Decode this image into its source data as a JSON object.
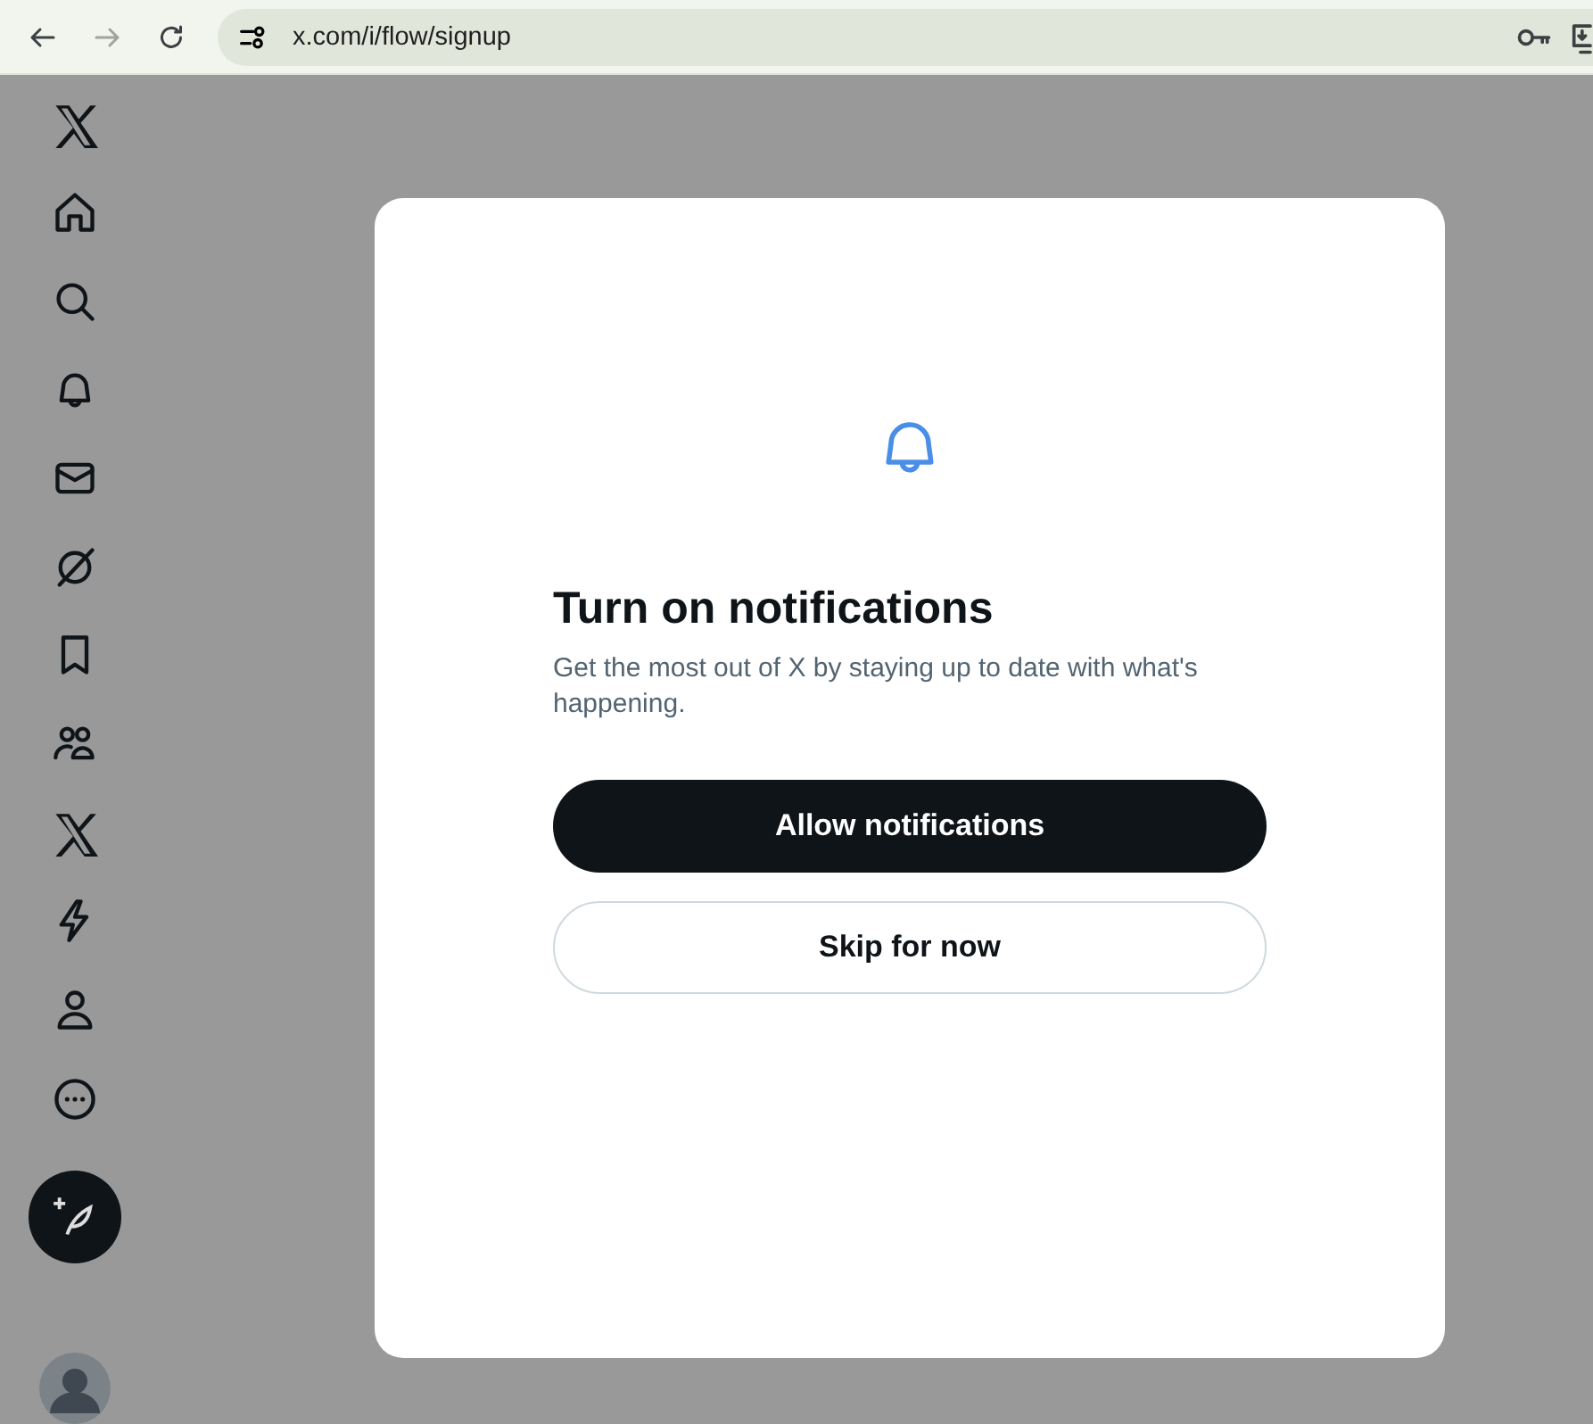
{
  "browser": {
    "nav": [
      {
        "kind": "back",
        "disabled": false
      },
      {
        "kind": "forward",
        "disabled": true
      },
      {
        "kind": "reload",
        "disabled": false
      }
    ],
    "url": "x.com/i/flow/signup"
  },
  "sidebar": {
    "items": [
      {
        "kind": "logo"
      },
      {
        "kind": "home"
      },
      {
        "kind": "search"
      },
      {
        "kind": "bell"
      },
      {
        "kind": "mail"
      },
      {
        "kind": "grok"
      },
      {
        "kind": "bookmark"
      },
      {
        "kind": "people"
      },
      {
        "kind": "logo"
      },
      {
        "kind": "bolt"
      },
      {
        "kind": "person"
      },
      {
        "kind": "more"
      }
    ]
  },
  "dialog": {
    "title": "Turn on notifications",
    "description": "Get the most out of X by staying up to date with what's happening.",
    "buttons": [
      {
        "label": "Allow notifications",
        "kind": "primary"
      },
      {
        "label": "Skip for now",
        "kind": "secondary"
      }
    ]
  }
}
